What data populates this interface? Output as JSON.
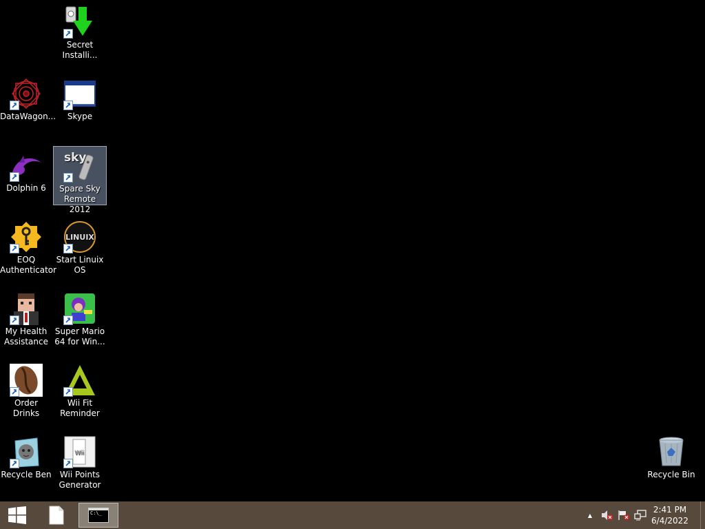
{
  "desktop": {
    "icons": [
      {
        "id": "secret-installer",
        "label": "Secret\nInstalli...",
        "icon": "green-download-arrow-icon"
      },
      {
        "id": "datawagon",
        "label": "DataWagon...",
        "icon": "red-mandala-icon"
      },
      {
        "id": "skype",
        "label": "Skype",
        "icon": "window-icon"
      },
      {
        "id": "dolphin",
        "label": "Dolphin 6",
        "icon": "purple-dolphin-icon"
      },
      {
        "id": "spare-sky-remote",
        "label": "Spare Sky\nRemote 2012",
        "icon": "sky-remote-icon",
        "selected": true
      },
      {
        "id": "eoq-authenticator",
        "label": "EOQ\nAuthenticator",
        "icon": "yellow-key-badge-icon"
      },
      {
        "id": "start-linuix",
        "label": "Start Linuix\nOS",
        "icon": "linuix-logo-icon",
        "logo_text": "LINUIX"
      },
      {
        "id": "my-health",
        "label": "My Health\nAssistance",
        "icon": "pixel-man-icon"
      },
      {
        "id": "super-mario",
        "label": "Super Mario\n64 for Win...",
        "icon": "mario-game-icon"
      },
      {
        "id": "order-drinks",
        "label": "Order Drinks",
        "icon": "coffee-bean-icon"
      },
      {
        "id": "wii-fit",
        "label": "Wii Fit\nReminder",
        "icon": "green-triangle-icon"
      },
      {
        "id": "recycle-ben",
        "label": "Recycle Ben",
        "icon": "recycle-ben-icon"
      },
      {
        "id": "wii-points",
        "label": "Wii Points\nGenerator",
        "icon": "wii-console-icon",
        "logo_text": "Wii"
      },
      {
        "id": "recycle-bin",
        "label": "Recycle Bin",
        "icon": "recycle-bin-icon"
      }
    ],
    "sky_logo_text": "sky"
  },
  "taskbar": {
    "start_icon": "windows-logo-icon",
    "pinned": [
      {
        "id": "file",
        "icon": "blank-document-icon"
      },
      {
        "id": "cmd",
        "icon": "command-prompt-icon",
        "active": true,
        "glyph": "C:\\_"
      }
    ],
    "tray": {
      "chevron": "▲",
      "icons": [
        "speaker-muted-icon",
        "flag-error-icon",
        "network-icon"
      ]
    },
    "clock": {
      "time": "2:41 PM",
      "date": "6/4/2022"
    }
  },
  "colors": {
    "desktop_bg": "#000000",
    "taskbar_bg": "#574a3c"
  }
}
